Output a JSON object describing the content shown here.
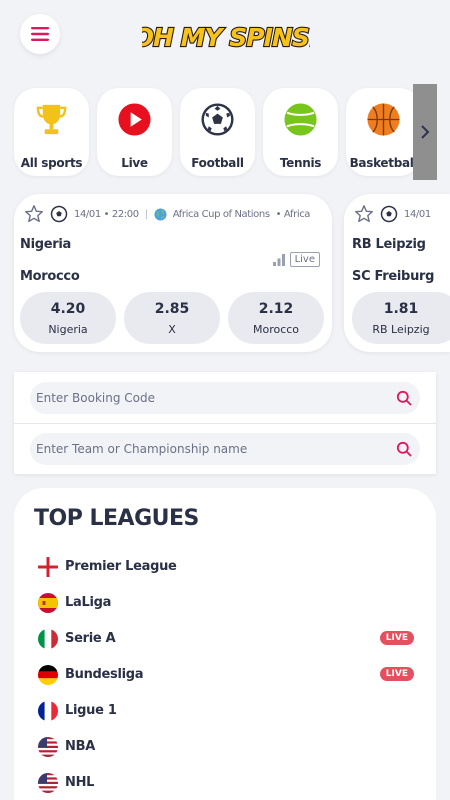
{
  "brand": {
    "logo_text": "OH MY SPINS!",
    "logo_color": "#f7c21a",
    "accent": "#e0165f"
  },
  "sports": [
    {
      "label": "All sports",
      "icon": "trophy-icon"
    },
    {
      "label": "Live",
      "icon": "play-icon"
    },
    {
      "label": "Football",
      "icon": "soccer-ball-icon"
    },
    {
      "label": "Tennis",
      "icon": "tennis-ball-icon"
    },
    {
      "label": "Basketball",
      "icon": "basketball-icon"
    }
  ],
  "matches": [
    {
      "datetime": "14/01 • 22:00",
      "competition": "Africa Cup of Nations",
      "region": "• Africa",
      "home": "Nigeria",
      "away": "Morocco",
      "live_label": "Live",
      "odds": [
        {
          "value": "4.20",
          "name": "Nigeria"
        },
        {
          "value": "2.85",
          "name": "X"
        },
        {
          "value": "2.12",
          "name": "Morocco"
        }
      ]
    },
    {
      "datetime": "14/01",
      "home": "RB Leipzig",
      "away": "SC Freiburg",
      "odds": [
        {
          "value": "1.81",
          "name": "RB Leipzig"
        }
      ]
    }
  ],
  "search": {
    "booking_placeholder": "Enter Booking Code",
    "team_placeholder": "Enter Team or Championship name"
  },
  "top_leagues": {
    "title": "TOP LEAGUES",
    "live_badge": "LIVE",
    "items": [
      {
        "name": "Premier League",
        "flag": "england-flag-icon",
        "live": false
      },
      {
        "name": "LaLiga",
        "flag": "spain-flag-icon",
        "live": false
      },
      {
        "name": "Serie A",
        "flag": "italy-flag-icon",
        "live": true
      },
      {
        "name": "Bundesliga",
        "flag": "germany-flag-icon",
        "live": true
      },
      {
        "name": "Ligue 1",
        "flag": "france-flag-icon",
        "live": false
      },
      {
        "name": "NBA",
        "flag": "usa-flag-icon",
        "live": false
      },
      {
        "name": "NHL",
        "flag": "usa-flag-icon",
        "live": false
      }
    ]
  }
}
